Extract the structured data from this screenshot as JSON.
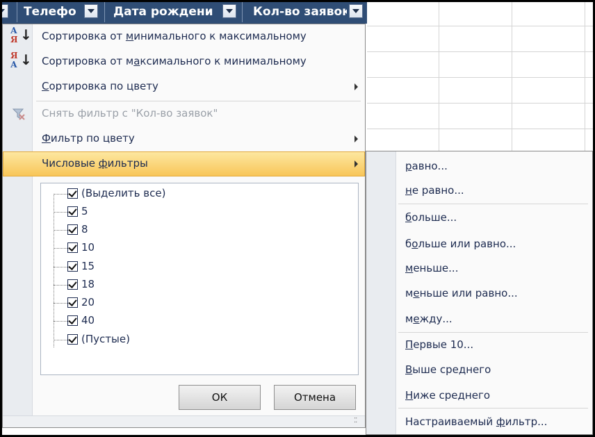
{
  "header": {
    "columns": [
      {
        "label": "Телефо"
      },
      {
        "label": "Дата рождени"
      },
      {
        "label": "Кол-во заявок"
      }
    ]
  },
  "menu": {
    "sort_asc": {
      "pre": "Сортировка от ",
      "key": "м",
      "post": "инимального к максимальному",
      "icon": "sort-ascending-icon"
    },
    "sort_desc": {
      "pre": "Сортировка от м",
      "key": "а",
      "post": "ксимального к минимальному",
      "icon": "sort-descending-icon"
    },
    "sort_color": {
      "pre": "",
      "key": "С",
      "post": "ортировка по цвету"
    },
    "clear_filter": {
      "label": "Снять фильтр с \"Кол-во заявок\"",
      "icon": "clear-filter-icon"
    },
    "filter_color": {
      "pre": "",
      "key": "Ф",
      "post": "ильтр по цвету"
    },
    "number_filters": {
      "pre": "Числовые ",
      "key": "ф",
      "post": "ильтры"
    }
  },
  "checklist": {
    "items": [
      "(Выделить все)",
      "5",
      "8",
      "10",
      "15",
      "18",
      "20",
      "40",
      "(Пустые)"
    ]
  },
  "buttons": {
    "ok": "ОК",
    "cancel": "Отмена"
  },
  "submenu": {
    "items": [
      {
        "pre": "",
        "key": "р",
        "post": "авно..."
      },
      {
        "pre": "",
        "key": "н",
        "post": "е равно..."
      },
      {
        "pre": "",
        "key": "б",
        "post": "ольше..."
      },
      {
        "pre": "б",
        "key": "о",
        "post": "льше или равно..."
      },
      {
        "pre": "",
        "key": "м",
        "post": "еньше..."
      },
      {
        "pre": "м",
        "key": "е",
        "post": "ньше или равно..."
      },
      {
        "pre": "м",
        "key": "е",
        "post": "жду..."
      },
      {
        "pre": "",
        "key": "П",
        "post": "ервые 10..."
      },
      {
        "pre": "",
        "key": "В",
        "post": "ыше среднего"
      },
      {
        "pre": "",
        "key": "Н",
        "post": "иже среднего"
      },
      {
        "pre": "Настраиваемый ",
        "key": "ф",
        "post": "ильтр..."
      }
    ]
  },
  "colors": {
    "header_bg": "#2f4d75",
    "highlight": "#f8c659",
    "text": "#1d2b50"
  }
}
